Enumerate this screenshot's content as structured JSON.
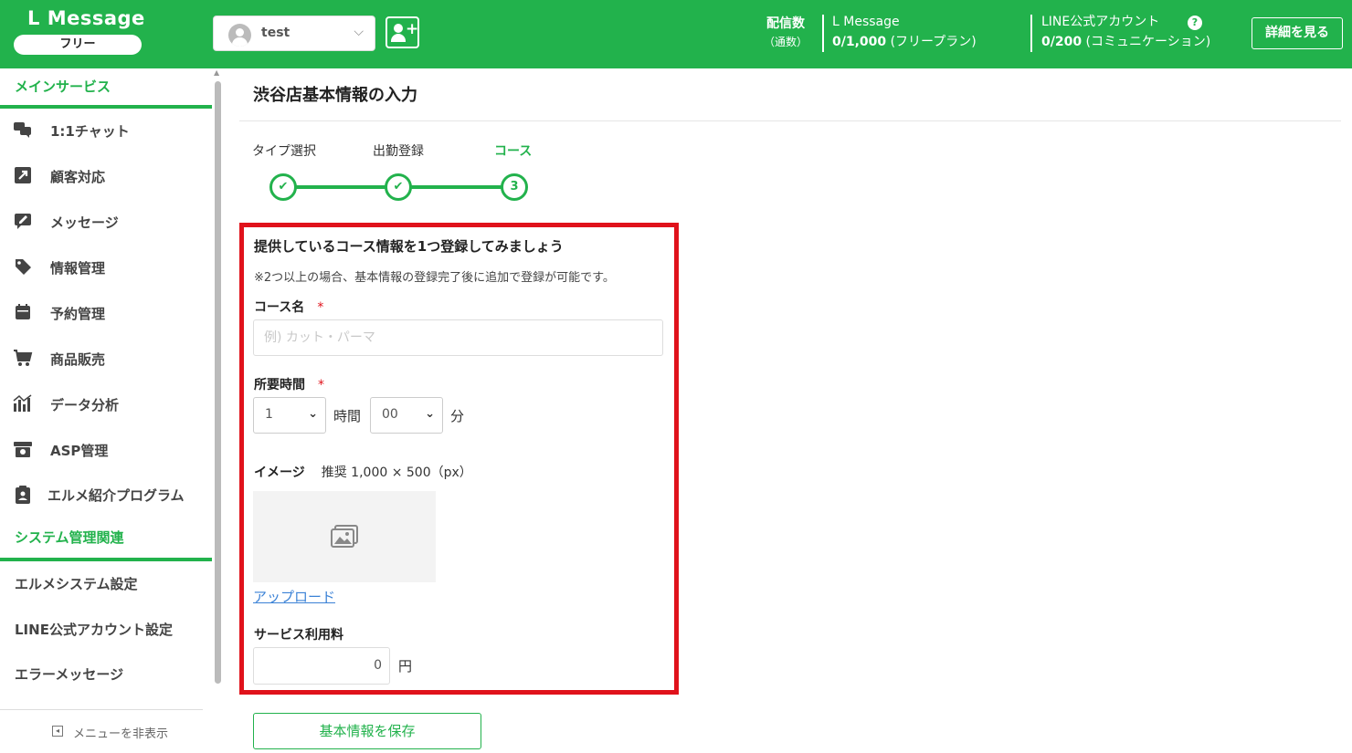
{
  "header": {
    "app_title": "L Message",
    "plan_badge": "フリー",
    "account_name": "test",
    "delivery_label_1": "配信数",
    "delivery_label_2": "（通数）",
    "lmessage_label": "L Message",
    "lmessage_value": "0/1,000",
    "lmessage_plan": "(フリープラン)",
    "line_label": "LINE公式アカウント",
    "line_value": "0/200",
    "line_plan": "(コミュニケーション)",
    "help_icon_text": "?",
    "detail_button": "詳細を見る"
  },
  "sidebar": {
    "section_main": "メインサービス",
    "items": [
      {
        "label": "1:1チャット",
        "icon": "chat-icon"
      },
      {
        "label": "顧客対応",
        "icon": "arrow-icon"
      },
      {
        "label": "メッセージ",
        "icon": "edit-message-icon"
      },
      {
        "label": "情報管理",
        "icon": "tag-icon"
      },
      {
        "label": "予約管理",
        "icon": "calendar-icon"
      },
      {
        "label": "商品販売",
        "icon": "cart-icon"
      },
      {
        "label": "データ分析",
        "icon": "chart-icon"
      },
      {
        "label": "ASP管理",
        "icon": "archive-icon"
      },
      {
        "label": "エルメ紹介プログラム",
        "icon": "clipboard-icon"
      }
    ],
    "section_system": "システム管理関連",
    "system_items": [
      "エルメシステム設定",
      "LINE公式アカウント設定",
      "エラーメッセージ"
    ],
    "hide_menu": "メニューを非表示"
  },
  "main": {
    "page_title": "渋谷店基本情報の入力",
    "steps": [
      {
        "label": "タイプ選択",
        "mark": "✔"
      },
      {
        "label": "出勤登録",
        "mark": "✔"
      },
      {
        "label": "コース",
        "mark": "3"
      }
    ],
    "form": {
      "title": "提供しているコース情報を1つ登録してみましょう",
      "note": "※2つ以上の場合、基本情報の登録完了後に追加で登録が可能です。",
      "course_name_label": "コース名",
      "required_mark": "*",
      "course_name_placeholder": "例) カット・パーマ",
      "duration_label": "所要時間",
      "hours_value": "1",
      "hours_unit": "時間",
      "minutes_value": "00",
      "minutes_unit": "分",
      "image_label": "イメージ",
      "image_hint": "推奨 1,000 × 500（px）",
      "upload_link": "アップロード",
      "fee_label": "サービス利用料",
      "fee_value": "0",
      "fee_unit": "円"
    },
    "save_button": "基本情報を保存"
  },
  "colors": {
    "brand_green": "#22b24c",
    "highlight_red": "#e0121b",
    "link_blue": "#3b82d6"
  }
}
